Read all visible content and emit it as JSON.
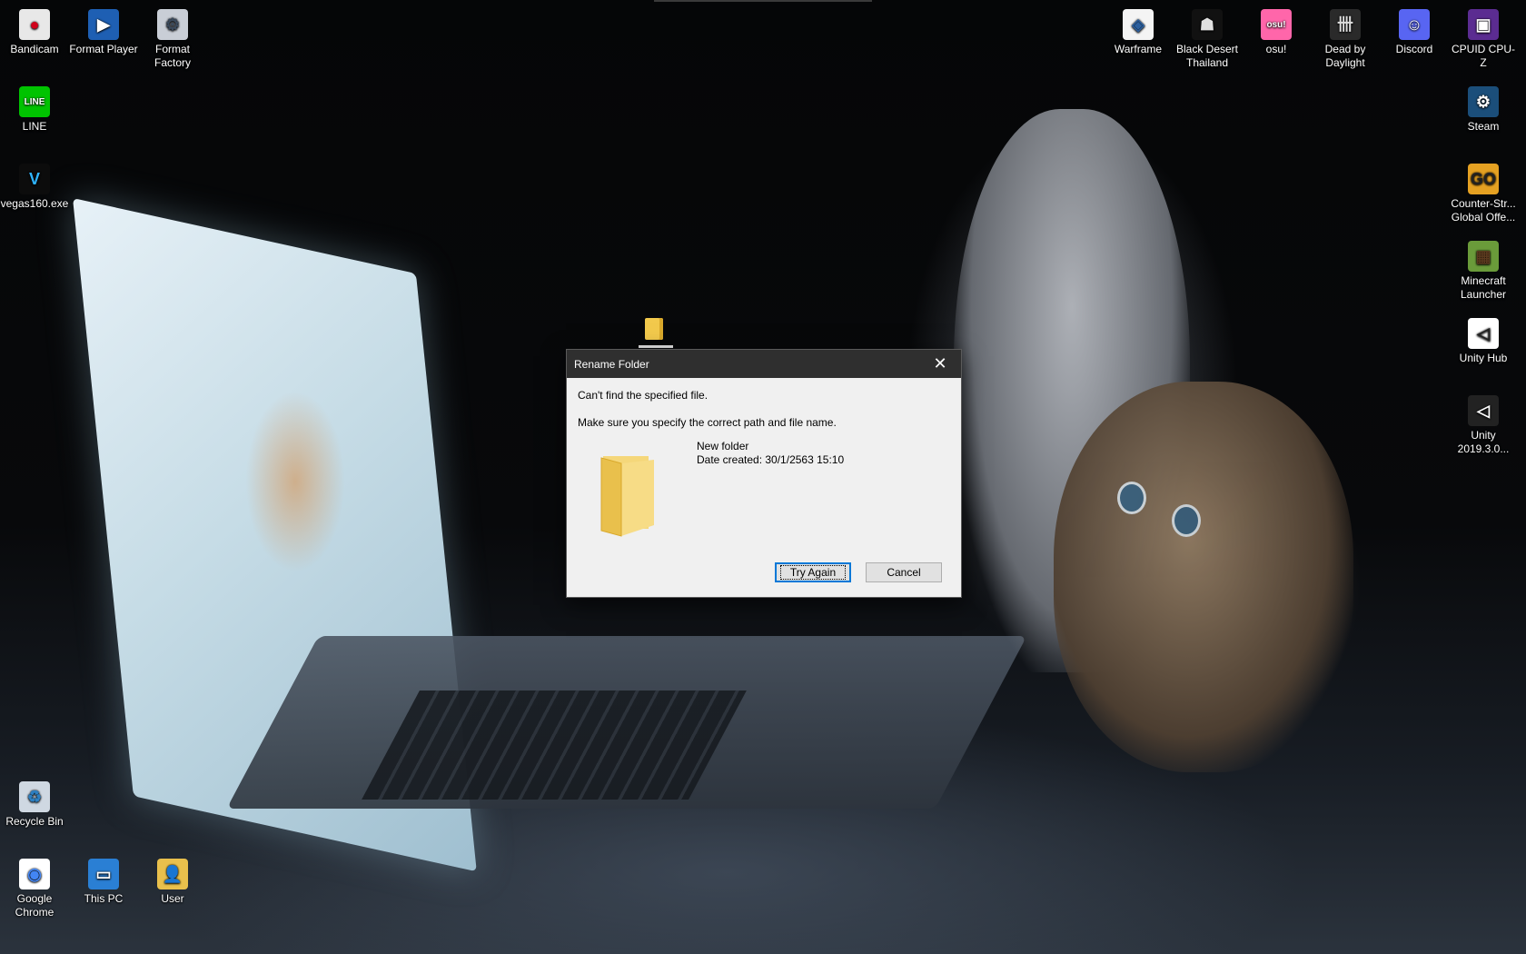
{
  "desktop_left": [
    {
      "label": "Bandicam",
      "icon": "bandicam-icon",
      "color": "#e8e8e8",
      "glyph": "●",
      "glyph_color": "#d0021b"
    },
    {
      "label": "Format Player",
      "icon": "format-player-icon",
      "color": "#1e5fb3",
      "glyph": "▶",
      "glyph_color": "#ffffff"
    },
    {
      "label": "Format Factory",
      "icon": "format-factory-icon",
      "color": "#c9ced6",
      "glyph": "⚙",
      "glyph_color": "#3b4a5c"
    },
    {
      "label": "LINE",
      "icon": "line-icon",
      "color": "#00c300",
      "glyph": "LINE",
      "glyph_color": "#ffffff"
    },
    {
      "label": "vegas160.exe",
      "icon": "vegas-icon",
      "color": "#0c0c0c",
      "glyph": "V",
      "glyph_color": "#2fb4ff"
    },
    {
      "label": "Recycle Bin",
      "icon": "recycle-bin-icon",
      "color": "#cfd8e2",
      "glyph": "♻",
      "glyph_color": "#2d7fc1"
    },
    {
      "label": "Google Chrome",
      "icon": "chrome-icon",
      "color": "#ffffff",
      "glyph": "◉",
      "glyph_color": "#4285f4"
    },
    {
      "label": "This PC",
      "icon": "this-pc-icon",
      "color": "#2a7fd4",
      "glyph": "▭",
      "glyph_color": "#ffffff"
    },
    {
      "label": "User",
      "icon": "user-folder-icon",
      "color": "#e9c04c",
      "glyph": "👤",
      "glyph_color": "#2c6b3a"
    }
  ],
  "desktop_right": [
    {
      "label": "Warframe",
      "icon": "warframe-icon",
      "color": "#f4f4f4",
      "glyph": "◈",
      "glyph_color": "#2b5f9e"
    },
    {
      "label": "Black Desert Thailand",
      "icon": "black-desert-icon",
      "color": "#111111",
      "glyph": "☗",
      "glyph_color": "#e0e0e0"
    },
    {
      "label": "osu!",
      "icon": "osu-icon",
      "color": "#ff66aa",
      "glyph": "osu!",
      "glyph_color": "#ffffff"
    },
    {
      "label": "Dead by Daylight",
      "icon": "dead-by-daylight-icon",
      "color": "#2a2a2a",
      "glyph": "卌",
      "glyph_color": "#dddddd"
    },
    {
      "label": "Discord",
      "icon": "discord-icon",
      "color": "#5865f2",
      "glyph": "☺",
      "glyph_color": "#ffffff"
    },
    {
      "label": "CPUID CPU-Z",
      "icon": "cpuz-icon",
      "color": "#5b2c91",
      "glyph": "▣",
      "glyph_color": "#ffffff"
    },
    {
      "label": "Steam",
      "icon": "steam-icon",
      "color": "#1b4e7a",
      "glyph": "⚙",
      "glyph_color": "#ffffff"
    },
    {
      "label": "Counter-Str... Global Offe...",
      "icon": "csgo-icon",
      "color": "#e5a122",
      "glyph": "GO",
      "glyph_color": "#222222"
    },
    {
      "label": "Minecraft Launcher",
      "icon": "minecraft-icon",
      "color": "#6a9b3a",
      "glyph": "▦",
      "glyph_color": "#5b3a1e"
    },
    {
      "label": "Unity Hub",
      "icon": "unity-hub-icon",
      "color": "#ffffff",
      "glyph": "◁",
      "glyph_color": "#222222"
    },
    {
      "label": "Unity 2019.3.0...",
      "icon": "unity-icon",
      "color": "#222222",
      "glyph": "◁",
      "glyph_color": "#ffffff"
    }
  ],
  "dialog": {
    "title": "Rename Folder",
    "close_glyph": "✕",
    "message": "Can't find the specified file.",
    "hint": "Make sure you specify the correct path and file name.",
    "folder_name": "New folder",
    "date_created": "Date created: 30/1/2563 15:10",
    "try_again": "Try Again",
    "cancel": "Cancel"
  }
}
